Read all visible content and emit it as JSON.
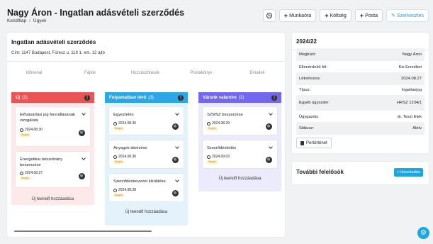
{
  "header": {
    "title": "Nagy Áron - Ingatlan adásvételi szerződés",
    "breadcrumb": [
      "Kezdőlap",
      "Ügyek"
    ],
    "toolbar": {
      "history_icon": "clock-icon",
      "munkaora_label": "Munkaóra",
      "koltseg_label": "Költség",
      "posta_label": "Posta",
      "szerkesztes_label": "Szerkesztés"
    }
  },
  "main": {
    "title": "Ingatlan adásvételi szerződés",
    "address": "Cím: 1147 Budapest, Füresz u. 119 1. em. 12 ajtó",
    "tabs": [
      "Idővonal",
      "Fájlok",
      "Hozzászólások",
      "Postakönyv",
      "Emailek"
    ],
    "columns": [
      {
        "title": "Új",
        "count": "(2)",
        "color": "#ea5455",
        "bg": "#fde9e9",
        "cards": [
          {
            "title": "Elővásárlási jog fennállásának vizsgálata",
            "date": "2024.08.30",
            "badge": "Sürgős"
          },
          {
            "title": "Energetikai tanusítvány beszerzése",
            "date": "2024.08.27",
            "badge": "Sürgős"
          }
        ],
        "add_label": "Új teendő hozzáadása"
      },
      {
        "title": "Folyamatban lévő",
        "count": "(3)",
        "color": "#2ba6e6",
        "bg": "#e4f2fb",
        "cards": [
          {
            "title": "Egyeztetés",
            "date": "2024.08.30",
            "badge": "Sürgős"
          },
          {
            "title": "Anyagok átnézése",
            "date": "2024.08.30",
            "badge": "Sürgős"
          },
          {
            "title": "Szerződéstervezet kiküldése",
            "date": "2024.08.28",
            "badge": "Sürgős"
          }
        ],
        "add_label": "Új teendő hozzáadása"
      },
      {
        "title": "Várunk valamire",
        "count": "(2)",
        "color": "#7367f0",
        "bg": "#ecebfb",
        "cards": [
          {
            "title": "SZMSZ beszerzése",
            "date": "2024.08.29",
            "badge": "Sürgős"
          },
          {
            "title": "Szerződéskötés",
            "date": "2024.09.03",
            "badge": "Sürgős"
          }
        ],
        "add_label": "Új teendő hozzáadása"
      }
    ]
  },
  "case": {
    "number": "2024/22",
    "properties": [
      {
        "label": "Megbízó:",
        "value": "Nagy Áron"
      },
      {
        "label": "Ellenérdekű fél:",
        "value": "Kis Erzsébet"
      },
      {
        "label": "Létrehozva:",
        "value": "2024.08.27"
      },
      {
        "label": "Típus:",
        "value": "Ingatlanjog"
      },
      {
        "label": "Egyéb ügyszám:",
        "value": "HRSZ 1234/1"
      },
      {
        "label": "Ügygazda:",
        "value": "dr. Teszt Elek"
      },
      {
        "label": "Státusz:",
        "value": "Aktív"
      }
    ],
    "history_button": "Pertörténet"
  },
  "responsibles": {
    "title": "További felelősök",
    "add_button": "Hozzáadás"
  },
  "colors": {
    "accent": "#1fa6e0",
    "new": "#ea5455",
    "in_progress": "#2ba6e6",
    "waiting": "#7367f0",
    "badge_bg": "#fff1c9",
    "badge_text": "#b98a1c"
  }
}
